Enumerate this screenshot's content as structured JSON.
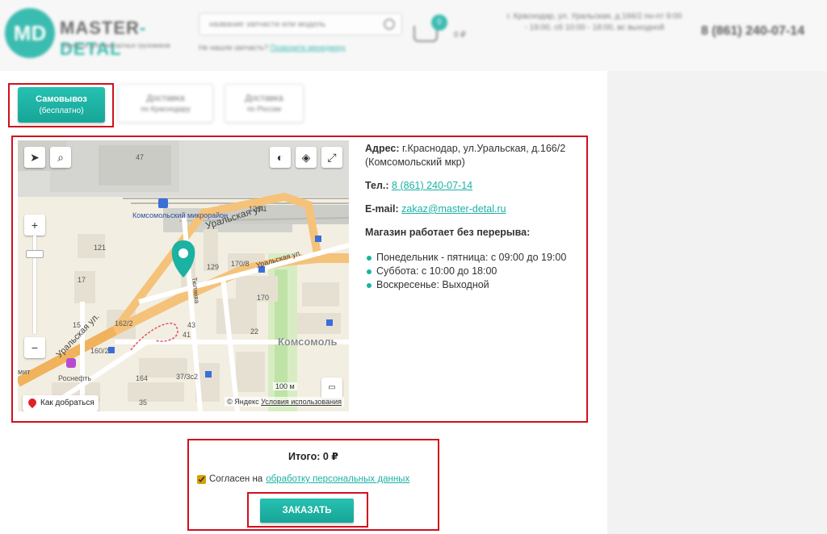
{
  "header": {
    "logo_mark": "MD",
    "logo_name_a": "MASTER",
    "logo_name_b": "-DETAL",
    "logo_tagline": "запчасти для импортных грузовиков",
    "search_placeholder": "название запчасти или модель",
    "search_hint": "Не нашли запчасть?",
    "search_hint_link": "Позвоните менеджеру",
    "cart_count": "0",
    "cart_sum": "0 ₽",
    "address": "г. Краснодар, ул. Уральская, д.166/2 пн-пт 9:00 - 19:00, сб 10:00 - 18:00, вс выходной",
    "phone": "8 (861) 240-07-14"
  },
  "tabs": [
    {
      "label": "Самовывоз",
      "sub": "(бесплатно)",
      "active": true
    },
    {
      "label": "Доставка",
      "sub": "по Краснодару",
      "active": false
    },
    {
      "label": "Доставка",
      "sub": "по России",
      "active": false
    }
  ],
  "map": {
    "labels": {
      "metro": "Комсомольский микрорайон",
      "street_main": "Уральская ул.",
      "street_main2": "Уральская ул.",
      "street_small": "Уральская ул.",
      "street_tyul": "Тюляева",
      "district": "Комсомоль",
      "gas": "Роснефть",
      "mit": "мит",
      "b47": "47",
      "b129_1": "129/1",
      "b121": "121",
      "b129": "129",
      "b170_8": "170/8",
      "b170": "170",
      "b162_2": "162/2",
      "b43": "43",
      "b41": "41",
      "b22": "22",
      "b160": "160/2",
      "b164": "164",
      "b37": "37/3с2",
      "b35": "35",
      "b15": "15",
      "b17": "17"
    },
    "route_button": "Как добраться",
    "copyright": "© Яндекс",
    "terms": "Условия использования",
    "scale": "100 м"
  },
  "info": {
    "address_label": "Адрес:",
    "address_value": "г.Краснодар, ул.Уральская, д.166/2 (Комсомольский мкр)",
    "phone_label": "Тел.:",
    "phone_value": "8 (861) 240-07-14",
    "email_label": "E-mail:",
    "email_value": "zakaz@master-detal.ru",
    "hours_title": "Магазин работает без перерыва:",
    "hours": [
      "Понедельник - пятница: с 09:00 до 19:00",
      "Суббота: с 10:00 до 18:00",
      "Воскресенье: Выходной"
    ]
  },
  "order": {
    "total": "Итого: 0 ₽",
    "agree_text": "Согласен на",
    "agree_link": "обработку персональных данных",
    "agree_checked": true,
    "submit": "ЗАКАЗАТЬ"
  },
  "colors": {
    "accent": "#1bb2a4",
    "highlight": "#d0101d"
  }
}
